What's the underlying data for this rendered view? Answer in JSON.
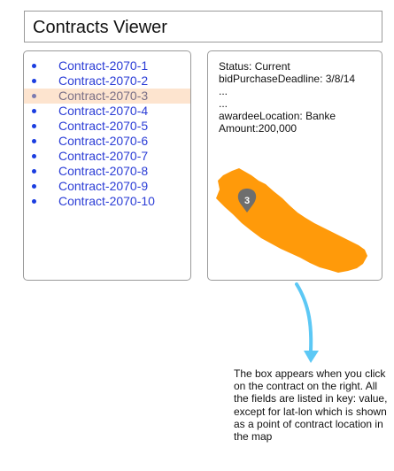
{
  "title": "Contracts Viewer",
  "contracts": [
    {
      "label": "Contract-2070-1",
      "selected": false
    },
    {
      "label": "Contract-2070-2",
      "selected": false
    },
    {
      "label": "Contract-2070-3",
      "selected": true
    },
    {
      "label": "Contract-2070-4",
      "selected": false
    },
    {
      "label": "Contract-2070-5",
      "selected": false
    },
    {
      "label": "Contract-2070-6",
      "selected": false
    },
    {
      "label": "Contract-2070-7",
      "selected": false
    },
    {
      "label": "Contract-2070-8",
      "selected": false
    },
    {
      "label": "Contract-2070-9",
      "selected": false
    },
    {
      "label": "Contract-2070-10",
      "selected": false
    }
  ],
  "details": {
    "lines": [
      "Status: Current",
      "bidPurchaseDeadline: 3/8/14",
      "...",
      "...",
      "awardeeLocation: Banke",
      "Amount:200,000"
    ]
  },
  "map": {
    "marker_label": "3",
    "fill_color": "#ff9a0a",
    "marker_color": "#6e6e6e"
  },
  "arrow_color": "#5cc8f5",
  "annotation": "The box appears when you click on the contract on the right. All the fields are listed in key: value, except for lat-lon which is shown as a point of contract location in the map"
}
